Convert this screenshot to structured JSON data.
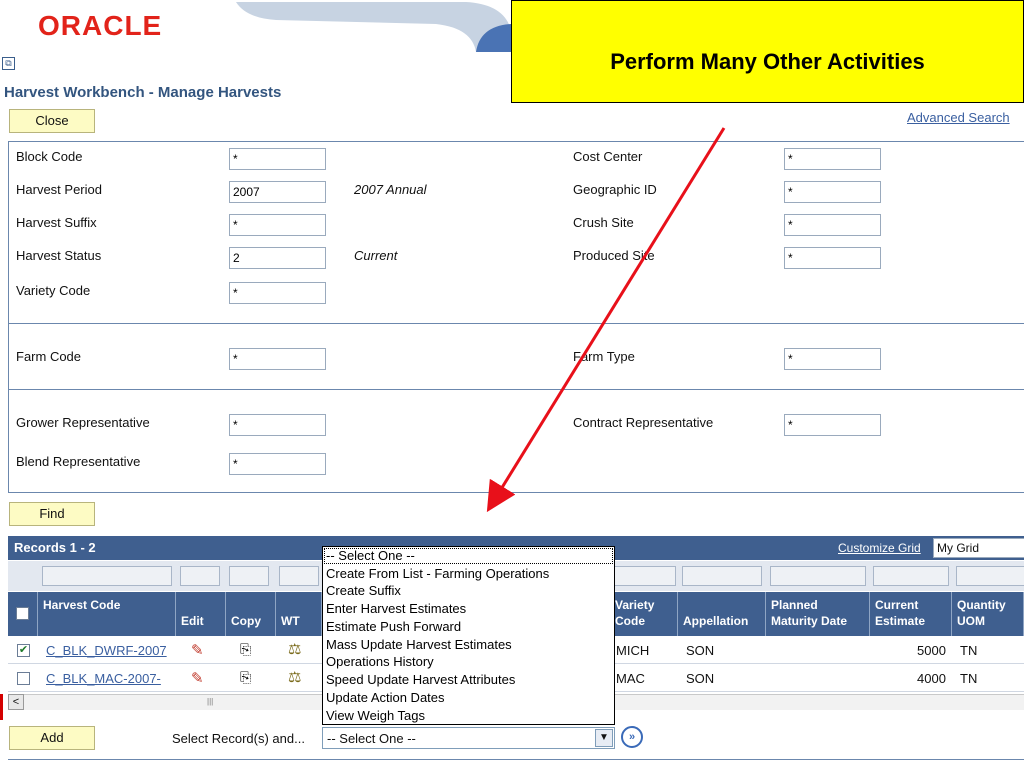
{
  "brand": {
    "logo_text": "ORACLE",
    "logo_color": "#e2231a"
  },
  "page": {
    "title": "Harvest Workbench - Manage Harvests"
  },
  "callout": {
    "text": "Perform Many Other Activities",
    "bg": "#ffff00",
    "arrow_color": "#e8101a"
  },
  "toolbar": {
    "close_label": "Close",
    "advanced_search_label": "Advanced Search",
    "find_label": "Find",
    "add_label": "Add"
  },
  "criteria": {
    "block_code": {
      "label": "Block Code",
      "value": "*"
    },
    "harvest_period": {
      "label": "Harvest Period",
      "value": "2007",
      "desc": "2007 Annual"
    },
    "harvest_suffix": {
      "label": "Harvest Suffix",
      "value": "*"
    },
    "harvest_status": {
      "label": "Harvest Status",
      "value": "2",
      "desc": "Current"
    },
    "variety_code": {
      "label": "Variety Code",
      "value": "*"
    },
    "cost_center": {
      "label": "Cost Center",
      "value": "*"
    },
    "geographic_id": {
      "label": "Geographic ID",
      "value": "*"
    },
    "crush_site": {
      "label": "Crush Site",
      "value": "*"
    },
    "produced_site": {
      "label": "Produced Site",
      "value": "*"
    },
    "farm_code": {
      "label": "Farm Code",
      "value": "*"
    },
    "farm_type": {
      "label": "Farm Type",
      "value": "*"
    },
    "grower_rep": {
      "label": "Grower Representative",
      "value": "*"
    },
    "contract_rep": {
      "label": "Contract Representative",
      "value": "*"
    },
    "blend_rep": {
      "label": "Blend Representative",
      "value": "*"
    }
  },
  "grid": {
    "title": "Records 1 - 2",
    "customize_label": "Customize Grid",
    "view_value": "My Grid",
    "columns": {
      "harvest_code": "Harvest Code",
      "edit": "Edit",
      "copy": "Copy",
      "wt": "WT",
      "variety_code": "Variety Code",
      "appellation": "Appellation",
      "planned_maturity": "Planned Maturity Date",
      "current_estimate": "Current Estimate",
      "quantity_uom": "Quantity UOM"
    },
    "rows": [
      {
        "checked": true,
        "harvest_code": "C_BLK_DWRF-2007",
        "variety": "MICH",
        "appellation": "SON",
        "estimate": "5000",
        "uom": "TN"
      },
      {
        "checked": false,
        "harvest_code": "C_BLK_MAC-2007-",
        "variety": "MAC",
        "appellation": "SON",
        "estimate": "4000",
        "uom": "TN"
      }
    ]
  },
  "bulk_action": {
    "label": "Select Record(s) and...",
    "selected": "-- Select One --",
    "options": [
      "-- Select One --",
      "Create From List - Farming Operations",
      "Create Suffix",
      "Enter Harvest Estimates",
      "Estimate Push Forward",
      "Mass Update Harvest Estimates",
      "Operations History",
      "Speed Update Harvest Attributes",
      "Update Action Dates",
      "View Weigh Tags"
    ]
  }
}
